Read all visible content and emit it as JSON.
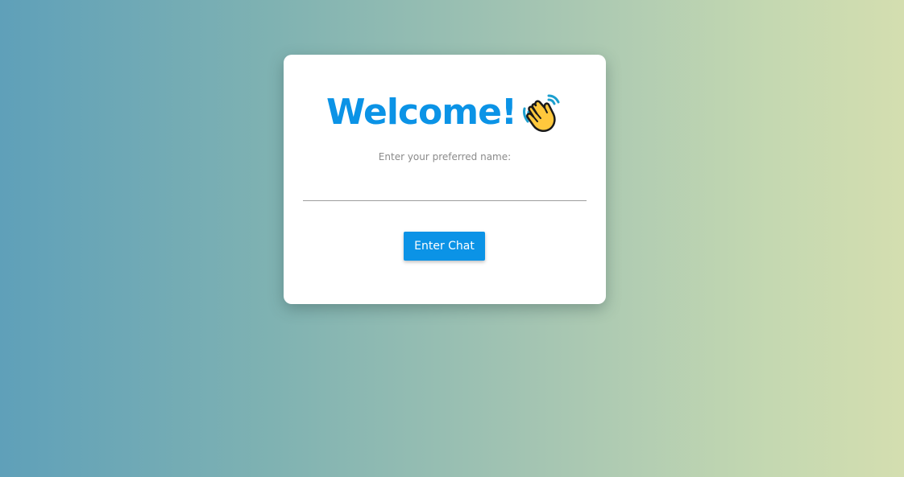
{
  "login": {
    "title": "Welcome!",
    "title_icon": "waving-hand-icon",
    "prompt": "Enter your preferred name:",
    "name_value": "",
    "name_placeholder": "",
    "enter_label": "Enter Chat"
  },
  "colors": {
    "accent": "#0b93e6",
    "card_background": "#ffffff",
    "gradient_start": "#5fa0b9",
    "gradient_end": "#d4deb0"
  }
}
